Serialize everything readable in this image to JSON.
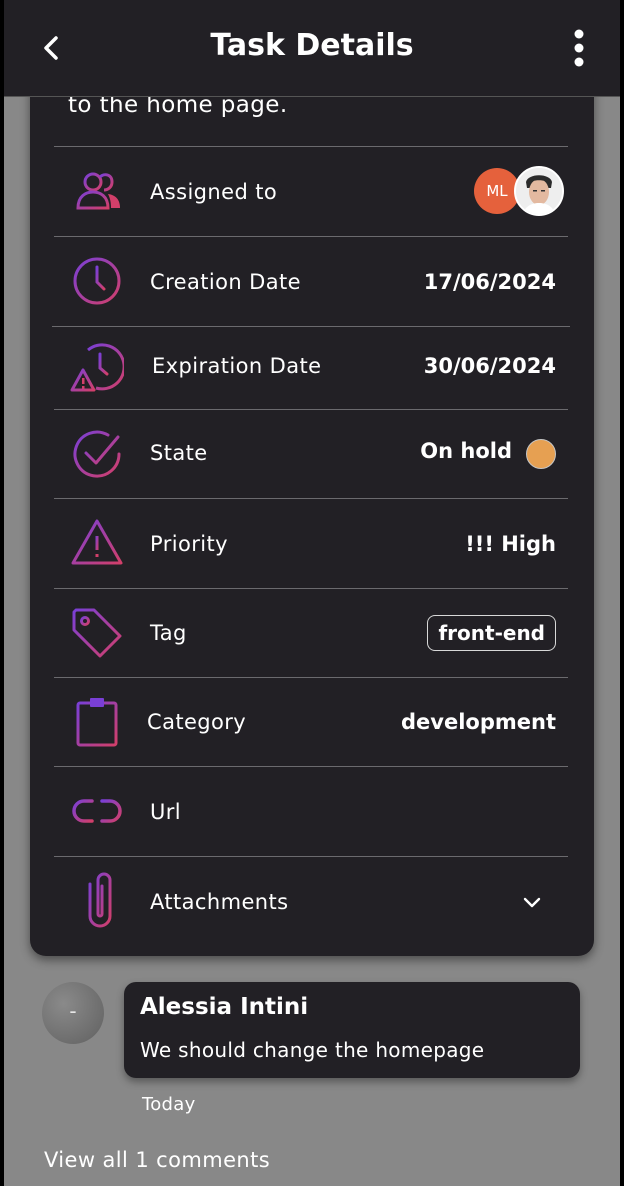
{
  "header": {
    "title": "Task Details",
    "back_icon": "back-arrow-icon",
    "menu_icon": "more-vert-icon"
  },
  "task": {
    "description_tail": "to the home page.",
    "assigned": {
      "label": "Assigned to",
      "avatars": [
        {
          "initials": "ML",
          "color": "#e5613c"
        },
        {
          "type": "photo"
        }
      ]
    },
    "creation": {
      "label": "Creation Date",
      "value": "17/06/2024"
    },
    "expiration": {
      "label": "Expiration Date",
      "value": "30/06/2024"
    },
    "state": {
      "label": "State",
      "value": "On hold",
      "color": "#e6a052"
    },
    "priority": {
      "label": "Priority",
      "value": "!!! High"
    },
    "tag": {
      "label": "Tag",
      "value": "front-end"
    },
    "category": {
      "label": "Category",
      "value": "development"
    },
    "url": {
      "label": "Url"
    },
    "attachments": {
      "label": "Attachments"
    }
  },
  "comments": {
    "items": [
      {
        "avatar_text": "-",
        "author": "Alessia Intini",
        "text": "We should change the homepage",
        "time": "Today"
      }
    ],
    "view_all_label": "View all 1 comments"
  },
  "colors": {
    "gradient_start": "#7a3fd6",
    "gradient_end": "#d23f6a",
    "card": "#222025",
    "background": "#888888"
  }
}
